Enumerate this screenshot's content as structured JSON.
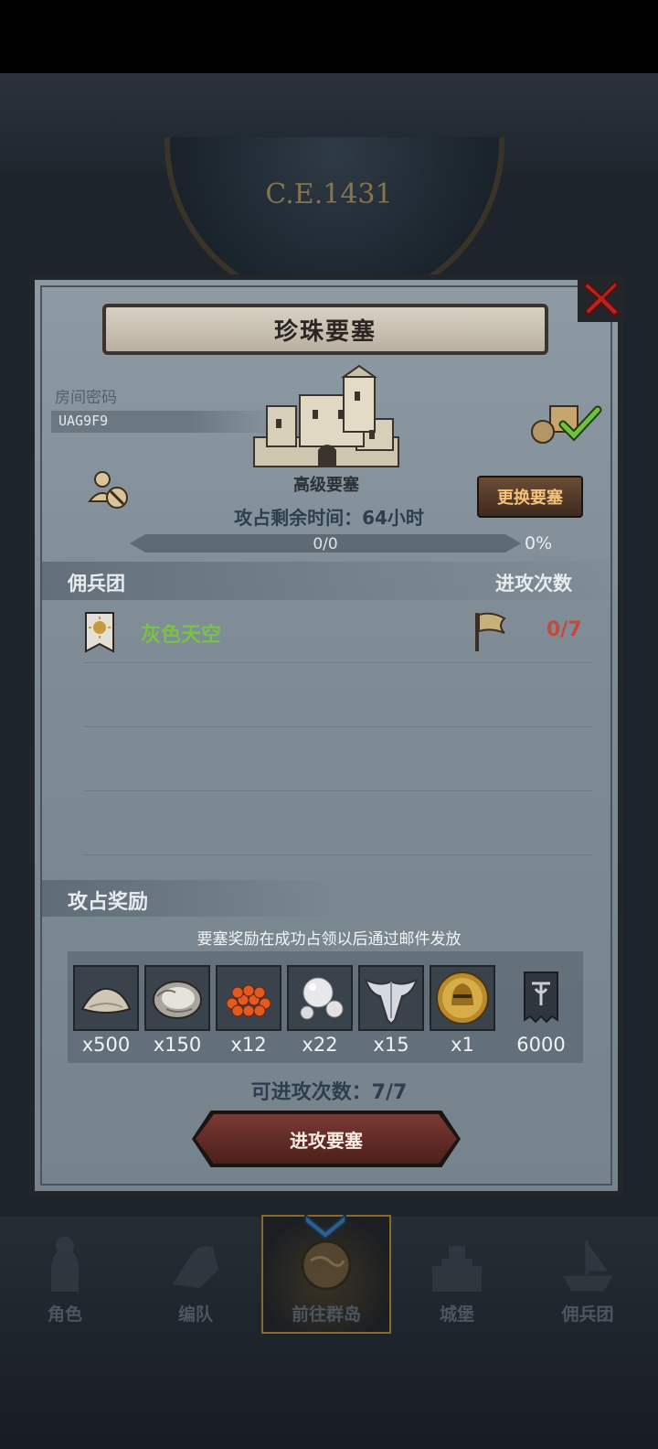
{
  "background": {
    "era_label": "C.E.1431"
  },
  "panel": {
    "title": "珍珠要塞",
    "room_label": "房间密码",
    "room_code": "UAG9F9",
    "fort_level": "高级要塞",
    "change_button": "更换要塞",
    "time_label": "攻占剩余时间：64小时",
    "progress_text": "0/0",
    "progress_percent": "0%",
    "progress_value": 0
  },
  "mercenaries": {
    "col_name": "佣兵团",
    "col_attacks": "进攻次数",
    "rows": [
      {
        "name": "灰色天空",
        "attacks": "0/7"
      }
    ]
  },
  "rewards": {
    "title": "攻占奖励",
    "note": "要塞奖励在成功占领以后通过邮件发放",
    "items": [
      {
        "icon": "sand-pile-icon",
        "qty": "x500"
      },
      {
        "icon": "oyster-icon",
        "qty": "x150"
      },
      {
        "icon": "fish-roe-icon",
        "qty": "x12"
      },
      {
        "icon": "pearl-icon",
        "qty": "x22"
      },
      {
        "icon": "silver-emblem-icon",
        "qty": "x15"
      },
      {
        "icon": "gold-helmet-coin-icon",
        "qty": "x1"
      },
      {
        "icon": "banner-icon",
        "qty": "6000"
      }
    ]
  },
  "attack": {
    "count_label": "可进攻次数：7/7",
    "button": "进攻要塞"
  },
  "nav": {
    "items": [
      {
        "label": "角色",
        "icon": "knight-icon"
      },
      {
        "label": "编队",
        "icon": "formation-icon"
      },
      {
        "label": "前往群岛",
        "icon": "globe-icon"
      },
      {
        "label": "城堡",
        "icon": "castle-icon"
      },
      {
        "label": "佣兵团",
        "icon": "ship-icon"
      }
    ]
  },
  "colors": {
    "accent_gold": "#c9a04a",
    "guild_green": "#79c14b",
    "count_red": "#c24a3e"
  }
}
